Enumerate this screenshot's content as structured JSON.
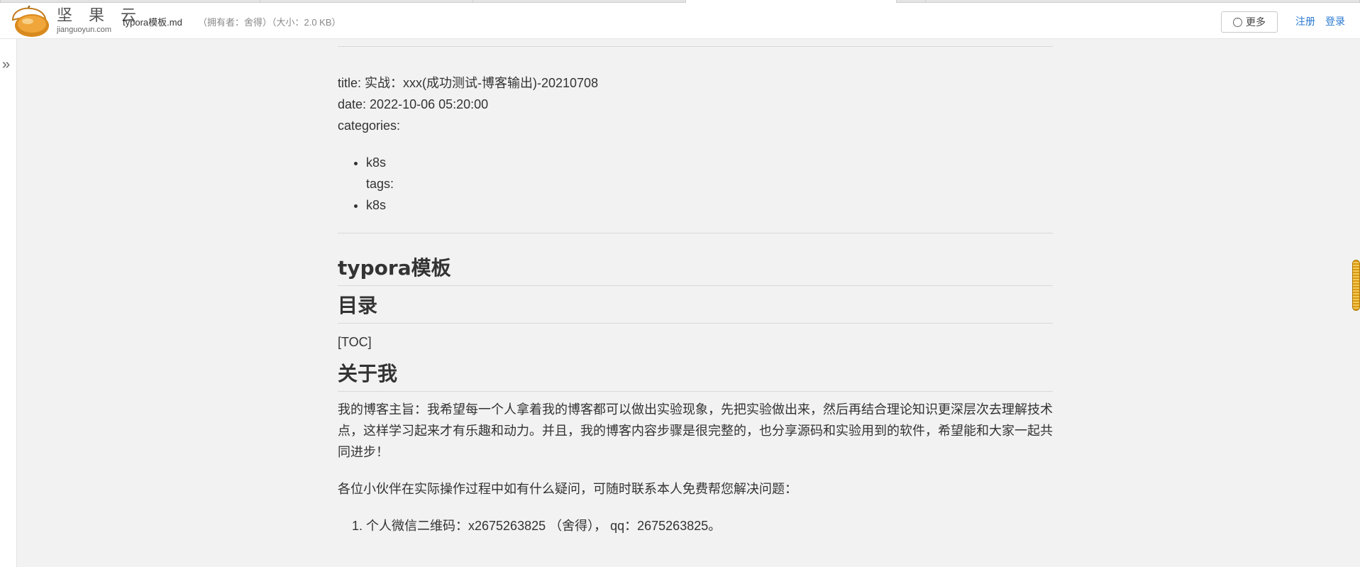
{
  "header": {
    "brand_cn": "坚 果 云",
    "brand_en": "jianguoyun.com",
    "filename": "typora模板.md",
    "fileinfo": "（拥有者：舍得）（大小：2.0 KB）",
    "more_label": "更多",
    "register_label": "注册",
    "login_label": "登录"
  },
  "colors": {
    "link": "#2a7ad2",
    "scroll_thumb": "#f3c75a",
    "background": "#f2f2f2"
  },
  "icons": {
    "logo": "acorn-logo-icon",
    "more": "ellipsis-circle-icon",
    "expand": "double-chevron-right-icon"
  },
  "sidebar": {
    "expand_glyph": "»"
  },
  "doc": {
    "front_matter": {
      "title_line": "title: 实战：xxx(成功测试-博客输出)-20210708",
      "date_line": "date: 2022-10-06 05:20:00",
      "categories_line": "categories:",
      "item1": "k8s",
      "tags_line": "tags:",
      "item2": "k8s"
    },
    "h_typora": "typora模板",
    "h_toc": "目录",
    "toc_text": "[TOC]",
    "h_about": "关于我",
    "about_para": "我的博客主旨：我希望每一个人拿着我的博客都可以做出实验现象，先把实验做出来，然后再结合理论知识更深层次去理解技术点，这样学习起来才有乐趣和动力。并且，我的博客内容步骤是很完整的，也分享源码和实验用到的软件，希望能和大家一起共同进步！",
    "help_para": "各位小伙伴在实际操作过程中如有什么疑问，可随时联系本人免费帮您解决问题：",
    "contact_item": "个人微信二维码：x2675263825 （舍得）， qq：2675263825。"
  }
}
